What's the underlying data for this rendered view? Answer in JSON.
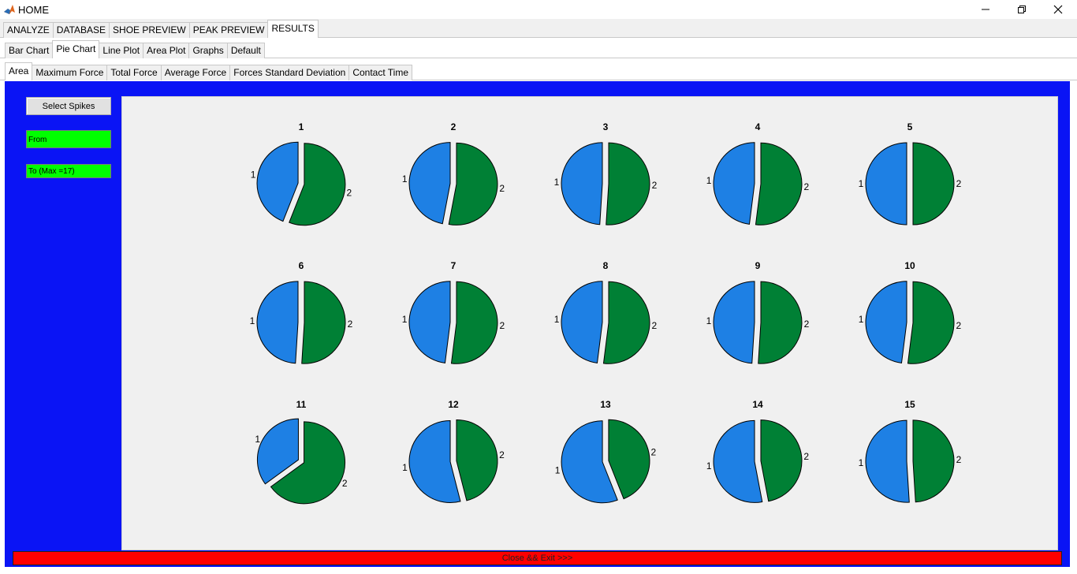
{
  "window": {
    "title": "HOME"
  },
  "tabs_main": [
    "ANALYZE",
    "DATABASE",
    "SHOE PREVIEW",
    "PEAK PREVIEW",
    "RESULTS"
  ],
  "tabs_main_active": 4,
  "tabs_chart": [
    "Bar Chart",
    "Pie Chart",
    "Line Plot",
    "Area Plot",
    "Graphs",
    "Default"
  ],
  "tabs_chart_active": 1,
  "tabs_metric": [
    "Area",
    "Maximum Force",
    "Total Force",
    "Average Force",
    "Forces Standard Deviation",
    "Contact Time"
  ],
  "tabs_metric_active": 0,
  "controls": {
    "select_label": "Select Spikes",
    "from_value": "From",
    "to_value": "To (Max =17)",
    "exit_label": "Close && Exit >>>"
  },
  "colors": {
    "slice1": "#1e80e4",
    "slice2": "#008035",
    "panel": "#0a14f5",
    "field": "#00ff00",
    "exit": "#ff0000"
  },
  "chart_data": {
    "type": "pie",
    "slice_labels": [
      "1",
      "2"
    ],
    "charts": [
      {
        "title": "1",
        "values": [
          0.44,
          0.56
        ]
      },
      {
        "title": "2",
        "values": [
          0.47,
          0.53
        ]
      },
      {
        "title": "3",
        "values": [
          0.49,
          0.51
        ]
      },
      {
        "title": "4",
        "values": [
          0.48,
          0.52
        ]
      },
      {
        "title": "5",
        "values": [
          0.5,
          0.5
        ]
      },
      {
        "title": "6",
        "values": [
          0.49,
          0.51
        ]
      },
      {
        "title": "7",
        "values": [
          0.48,
          0.52
        ]
      },
      {
        "title": "8",
        "values": [
          0.48,
          0.52
        ]
      },
      {
        "title": "9",
        "values": [
          0.49,
          0.51
        ]
      },
      {
        "title": "10",
        "values": [
          0.48,
          0.52
        ]
      },
      {
        "title": "11",
        "values": [
          0.35,
          0.65
        ]
      },
      {
        "title": "12",
        "values": [
          0.54,
          0.46
        ]
      },
      {
        "title": "13",
        "values": [
          0.56,
          0.44
        ]
      },
      {
        "title": "14",
        "values": [
          0.53,
          0.47
        ]
      },
      {
        "title": "15",
        "values": [
          0.51,
          0.49
        ]
      }
    ]
  }
}
